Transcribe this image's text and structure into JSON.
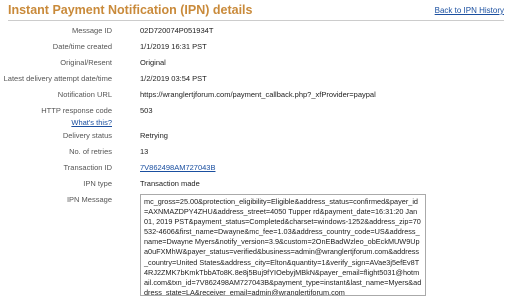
{
  "header": {
    "title": "Instant Payment Notification (IPN) details",
    "back_link": "Back to IPN History"
  },
  "fields": [
    {
      "label": "Message ID",
      "value": "02D720074P051934T"
    },
    {
      "label": "Date/time created",
      "value": "1/1/2019 16:31 PST"
    },
    {
      "label": "Original/Resent",
      "value": "Original"
    },
    {
      "label": "Latest delivery attempt date/time",
      "value": "1/2/2019 03:54 PST"
    },
    {
      "label": "Notification URL",
      "value": "https://wranglertjforum.com/payment_callback.php?_xfProvider=paypal"
    },
    {
      "label": "HTTP response code",
      "value": "503"
    },
    {
      "label": "Delivery status",
      "value": "Retrying"
    },
    {
      "label": "No. of retries",
      "value": "13"
    },
    {
      "label": "Transaction ID",
      "value": "7V862498AM727043B"
    },
    {
      "label": "IPN type",
      "value": "Transaction made"
    },
    {
      "label": "IPN Message",
      "value": "mc_gross=25.00&protection_eligibility=Eligible&address_status=confirmed&payer_id=AXNMAZDPY4ZHU&address_street=4050 Tupper rd&payment_date=16:31:20 Jan 01, 2019 PST&payment_status=Completed&charset=windows-1252&address_zip=70532-4606&first_name=Dwayne&mc_fee=1.03&address_country_code=US&address_name=Dwayne Myers&notify_version=3.9&custom=2OnEBadWzleo_obEckMUW9Upa0uFXMhW&payer_status=verified&business=admin@wranglertjforum.com&address_country=United States&address_city=Elton&quantity=1&verify_sign=AVae3j5efEv8T4RJ2ZMK7bKmkTbbATo8K.8e8j5Buj9fYIOebyjMBkN&payer_email=flight5031@hotmail.com&txn_id=7V862498AM727043B&payment_type=instant&last_name=Myers&address_state=LA&receiver_email=admin@wranglertjforum.com"
    }
  ],
  "whats_this": "What's this?",
  "colors": {
    "title": "#c98a3a",
    "link": "#1a4fa0"
  }
}
